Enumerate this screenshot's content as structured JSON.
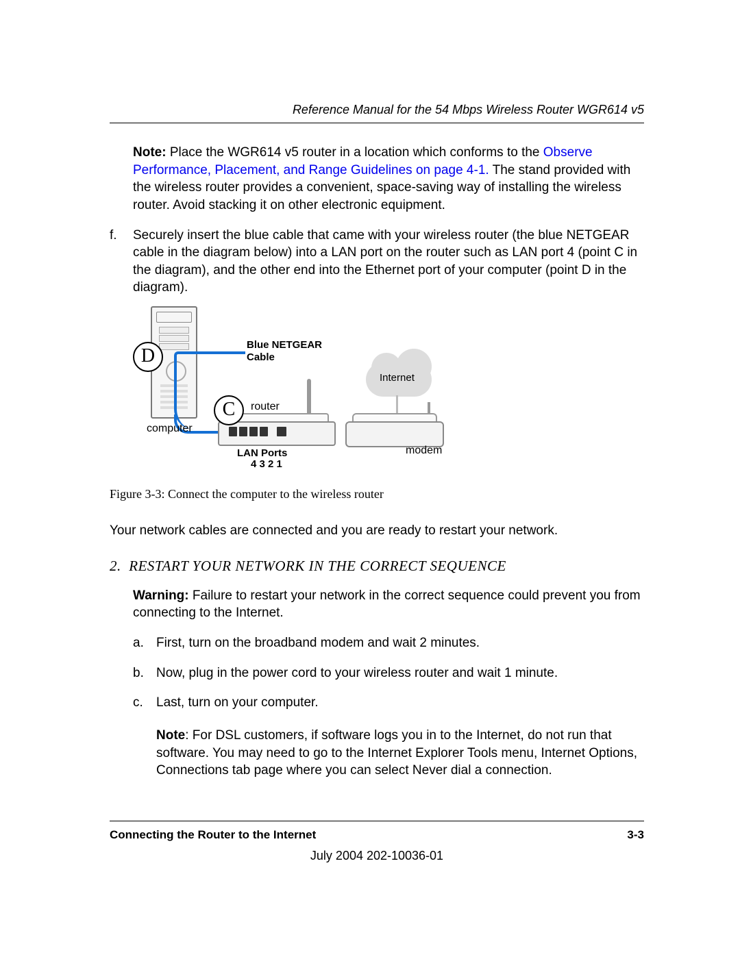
{
  "header": {
    "title": "Reference Manual for the 54 Mbps Wireless Router WGR614 v5"
  },
  "note": {
    "label": "Note:",
    "pre": " Place the WGR614 v5 router in a location which conforms to the ",
    "link": "Observe Performance, Placement, and Range Guidelines",
    "link_suffix": " on page 4-1.",
    "post": " The stand provided with the wireless router provides a convenient, space-saving way of installing the wireless router. Avoid stacking it on other electronic equipment."
  },
  "step_f": {
    "marker": "f.",
    "text": "Securely insert the blue cable that came with your wireless router (the blue NETGEAR cable in the diagram below) into a LAN port on the router such as LAN port 4 (point C in the diagram), and the other end into the Ethernet port of your computer (point D in the diagram)."
  },
  "diagram": {
    "callout_d": "D",
    "callout_c": "C",
    "cable_label_1": "Blue NETGEAR",
    "cable_label_2": "Cable",
    "internet": "Internet",
    "router": "router",
    "computer": "computer",
    "modem": "modem",
    "lan_ports_1": "LAN Ports",
    "lan_ports_2": "4 3 2 1"
  },
  "figure_caption": "Figure 3-3:  Connect the computer to the wireless router",
  "ready_text": "Your network cables are connected and you are ready to restart your network.",
  "section2": {
    "num": "2.",
    "head_pre": "R",
    "head_rest": "ESTART YOUR NETWORK IN THE CORRECT SEQUENCE"
  },
  "warning": {
    "label": "Warning:",
    "text": " Failure to restart your network in the correct sequence could prevent you from connecting to the Internet."
  },
  "steps2": {
    "a": {
      "marker": "a.",
      "text": "First, turn on the broadband modem and wait 2 minutes."
    },
    "b": {
      "marker": "b.",
      "text": "Now, plug in the power cord to your wireless router and wait 1 minute."
    },
    "c": {
      "marker": "c.",
      "text": "Last, turn on your computer."
    }
  },
  "note2": {
    "label": "Note",
    "text": ": For DSL customers, if software logs you in to the Internet, do not run that software. You may need to go to the Internet Explorer Tools menu, Internet Options, Connections tab page where you can select Never dial a connection."
  },
  "footer": {
    "left": "Connecting the Router to the Internet",
    "right": "3-3",
    "date": "July 2004 202-10036-01"
  }
}
